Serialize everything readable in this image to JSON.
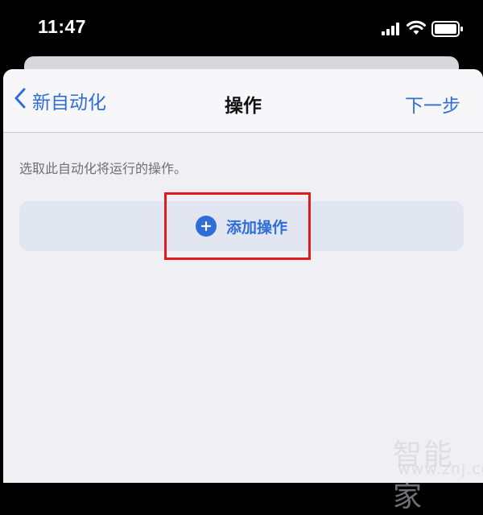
{
  "status_bar": {
    "time": "11:47",
    "signal_icon": "cellular-signal-icon",
    "wifi_icon": "wifi-icon",
    "battery_icon": "battery-icon"
  },
  "nav": {
    "back_label": "新自动化",
    "back_icon": "chevron-left-icon",
    "title": "操作",
    "next_label": "下一步"
  },
  "content": {
    "hint": "选取此自动化将运行的操作。",
    "add_action_label": "添加操作",
    "add_icon": "plus-circle-icon"
  },
  "watermark": {
    "text": "智能家",
    "url": "www.znj.com"
  },
  "colors": {
    "accent": "#2f6ed8",
    "background": "#efeff4",
    "highlight": "#e21a1a"
  }
}
